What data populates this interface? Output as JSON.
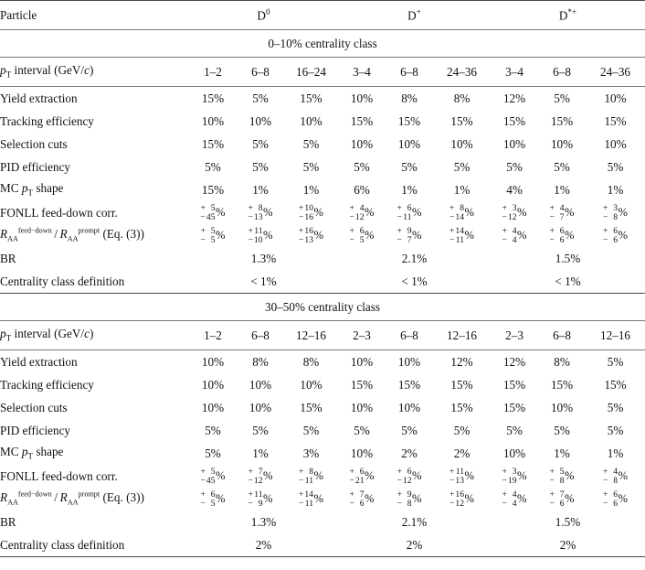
{
  "table": {
    "row_label_header": "Particle",
    "particles": [
      {
        "base": "D",
        "sup": "0"
      },
      {
        "base": "D",
        "sup": "+"
      },
      {
        "base": "D",
        "sup": "*+"
      }
    ],
    "pt_row_label": {
      "prefix": "p",
      "sub": "T",
      "text": " interval (GeV/",
      "italic_c": "c",
      "suffix": ")"
    },
    "sections": [
      {
        "title": "0–10% centrality class",
        "pt_intervals": [
          "1–2",
          "6–8",
          "16–24",
          "3–4",
          "6–8",
          "24–36",
          "3–4",
          "6–8",
          "24–36"
        ],
        "rows": [
          {
            "label": "Yield extraction",
            "type": "plain",
            "values": [
              "15%",
              "5%",
              "15%",
              "10%",
              "8%",
              "8%",
              "12%",
              "5%",
              "10%"
            ]
          },
          {
            "label": "Tracking efficiency",
            "type": "plain",
            "values": [
              "10%",
              "10%",
              "10%",
              "15%",
              "15%",
              "15%",
              "15%",
              "15%",
              "15%"
            ]
          },
          {
            "label": "Selection cuts",
            "type": "plain",
            "values": [
              "15%",
              "5%",
              "5%",
              "10%",
              "10%",
              "10%",
              "10%",
              "10%",
              "10%"
            ]
          },
          {
            "label": "PID efficiency",
            "type": "plain",
            "values": [
              "5%",
              "5%",
              "5%",
              "5%",
              "5%",
              "5%",
              "5%",
              "5%",
              "5%"
            ]
          },
          {
            "label": "MC pT shape",
            "label_kind": "mc_pt",
            "type": "plain",
            "values": [
              "15%",
              "1%",
              "1%",
              "6%",
              "1%",
              "1%",
              "4%",
              "1%",
              "1%"
            ]
          },
          {
            "label": "FONLL feed-down corr.",
            "type": "asym",
            "values": [
              {
                "up_sign": "+",
                "up": "5",
                "dn_sign": "−",
                "dn": "45"
              },
              {
                "up_sign": "+",
                "up": "8",
                "dn_sign": "−",
                "dn": "13"
              },
              {
                "up_sign": "+",
                "up": "10",
                "dn_sign": "−",
                "dn": "16"
              },
              {
                "up_sign": "+",
                "up": "4",
                "dn_sign": "−",
                "dn": "12"
              },
              {
                "up_sign": "+",
                "up": "6",
                "dn_sign": "−",
                "dn": "11"
              },
              {
                "up_sign": "+",
                "up": "8",
                "dn_sign": "−",
                "dn": "14"
              },
              {
                "up_sign": "+",
                "up": "3",
                "dn_sign": "−",
                "dn": "12"
              },
              {
                "up_sign": "+",
                "up": "4",
                "dn_sign": "−",
                "dn": "7"
              },
              {
                "up_sign": "+",
                "up": "3",
                "dn_sign": "−",
                "dn": "8"
              }
            ]
          },
          {
            "label": "RAA feed-down / RAA prompt (Eq. (3))",
            "label_kind": "raa",
            "type": "asym",
            "values": [
              {
                "up_sign": "+",
                "up": "5",
                "dn_sign": "−",
                "dn": "5"
              },
              {
                "up_sign": "+",
                "up": "11",
                "dn_sign": "−",
                "dn": "10"
              },
              {
                "up_sign": "+",
                "up": "16",
                "dn_sign": "−",
                "dn": "13"
              },
              {
                "up_sign": "+",
                "up": "6",
                "dn_sign": "−",
                "dn": "5"
              },
              {
                "up_sign": "+",
                "up": "9",
                "dn_sign": "−",
                "dn": "7"
              },
              {
                "up_sign": "+",
                "up": "14",
                "dn_sign": "−",
                "dn": "11"
              },
              {
                "up_sign": "+",
                "up": "4",
                "dn_sign": "−",
                "dn": "4"
              },
              {
                "up_sign": "+",
                "up": "6",
                "dn_sign": "−",
                "dn": "6"
              },
              {
                "up_sign": "+",
                "up": "6",
                "dn_sign": "−",
                "dn": "6"
              }
            ]
          },
          {
            "label": "BR",
            "type": "merged",
            "values": [
              "1.3%",
              "2.1%",
              "1.5%"
            ]
          },
          {
            "label": "Centrality class definition",
            "type": "merged",
            "values": [
              "< 1%",
              "< 1%",
              "< 1%"
            ]
          }
        ]
      },
      {
        "title": "30–50% centrality class",
        "pt_intervals": [
          "1–2",
          "6–8",
          "12–16",
          "2–3",
          "6–8",
          "12–16",
          "2–3",
          "6–8",
          "12–16"
        ],
        "rows": [
          {
            "label": "Yield extraction",
            "type": "plain",
            "values": [
              "10%",
              "8%",
              "8%",
              "10%",
              "10%",
              "12%",
              "12%",
              "8%",
              "5%"
            ]
          },
          {
            "label": "Tracking efficiency",
            "type": "plain",
            "values": [
              "10%",
              "10%",
              "10%",
              "15%",
              "15%",
              "15%",
              "15%",
              "15%",
              "15%"
            ]
          },
          {
            "label": "Selection cuts",
            "type": "plain",
            "values": [
              "10%",
              "10%",
              "15%",
              "10%",
              "10%",
              "15%",
              "15%",
              "10%",
              "5%"
            ]
          },
          {
            "label": "PID efficiency",
            "type": "plain",
            "values": [
              "5%",
              "5%",
              "5%",
              "5%",
              "5%",
              "5%",
              "5%",
              "5%",
              "5%"
            ]
          },
          {
            "label": "MC pT shape",
            "label_kind": "mc_pt",
            "type": "plain",
            "values": [
              "5%",
              "1%",
              "3%",
              "10%",
              "2%",
              "2%",
              "10%",
              "1%",
              "1%"
            ]
          },
          {
            "label": "FONLL feed-down corr.",
            "type": "asym",
            "values": [
              {
                "up_sign": "+",
                "up": "5",
                "dn_sign": "−",
                "dn": "45"
              },
              {
                "up_sign": "+",
                "up": "7",
                "dn_sign": "−",
                "dn": "12"
              },
              {
                "up_sign": "+",
                "up": "8",
                "dn_sign": "−",
                "dn": "11"
              },
              {
                "up_sign": "+",
                "up": "6",
                "dn_sign": "−",
                "dn": "21"
              },
              {
                "up_sign": "+",
                "up": "6",
                "dn_sign": "−",
                "dn": "12"
              },
              {
                "up_sign": "+",
                "up": "11",
                "dn_sign": "−",
                "dn": "13"
              },
              {
                "up_sign": "+",
                "up": "3",
                "dn_sign": "−",
                "dn": "19"
              },
              {
                "up_sign": "+",
                "up": "5",
                "dn_sign": "−",
                "dn": "8"
              },
              {
                "up_sign": "+",
                "up": "4",
                "dn_sign": "−",
                "dn": "8"
              }
            ]
          },
          {
            "label": "RAA feed-down / RAA prompt (Eq. (3))",
            "label_kind": "raa",
            "type": "asym",
            "values": [
              {
                "up_sign": "+",
                "up": "6",
                "dn_sign": "−",
                "dn": "5"
              },
              {
                "up_sign": "+",
                "up": "11",
                "dn_sign": "−",
                "dn": "9"
              },
              {
                "up_sign": "+",
                "up": "14",
                "dn_sign": "−",
                "dn": "11"
              },
              {
                "up_sign": "+",
                "up": "7",
                "dn_sign": "−",
                "dn": "6"
              },
              {
                "up_sign": "+",
                "up": "9",
                "dn_sign": "−",
                "dn": "8"
              },
              {
                "up_sign": "+",
                "up": "16",
                "dn_sign": "−",
                "dn": "12"
              },
              {
                "up_sign": "+",
                "up": "4",
                "dn_sign": "−",
                "dn": "4"
              },
              {
                "up_sign": "+",
                "up": "7",
                "dn_sign": "−",
                "dn": "6"
              },
              {
                "up_sign": "+",
                "up": "6",
                "dn_sign": "−",
                "dn": "6"
              }
            ]
          },
          {
            "label": "BR",
            "type": "merged",
            "values": [
              "1.3%",
              "2.1%",
              "1.5%"
            ]
          },
          {
            "label": "Centrality class definition",
            "type": "merged",
            "values": [
              "2%",
              "2%",
              "2%"
            ]
          }
        ]
      }
    ]
  }
}
